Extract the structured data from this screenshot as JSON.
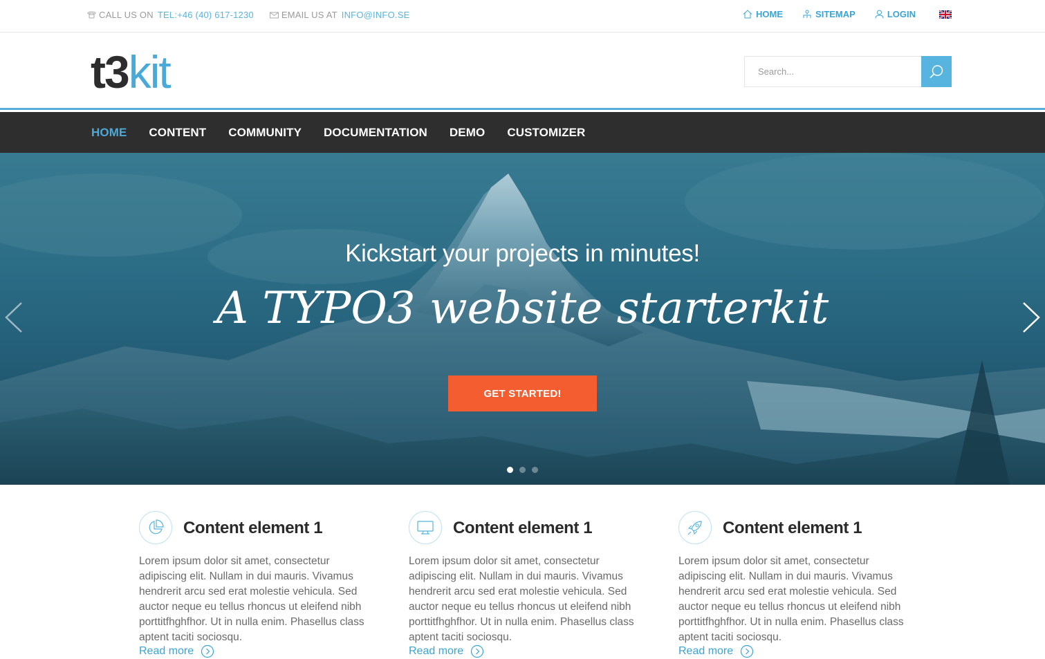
{
  "topbar": {
    "call_label": "CALL US ON",
    "call_value": "TEL:+46 (40) 617-1230",
    "email_label": "EMAIL US AT",
    "email_value": "INFO@INFO.SE",
    "links": [
      {
        "label": "HOME",
        "icon": "home-icon"
      },
      {
        "label": "SITEMAP",
        "icon": "sitemap-icon"
      },
      {
        "label": "LOGIN",
        "icon": "user-icon"
      }
    ],
    "language_flag": "uk-flag-icon"
  },
  "header": {
    "logo_dark": "t3",
    "logo_light": "kit",
    "search_placeholder": "Search..."
  },
  "nav": {
    "items": [
      "HOME",
      "CONTENT",
      "COMMUNITY",
      "DOCUMENTATION",
      "DEMO",
      "CUSTOMIZER"
    ],
    "active_index": 0
  },
  "hero": {
    "subtitle": "Kickstart your projects in minutes!",
    "title": "A TYPO3 website starterkit",
    "cta_label": "GET STARTED!",
    "slide_count": 3,
    "active_slide": 0
  },
  "features": [
    {
      "icon": "pie-chart-icon",
      "title": "Content element 1",
      "text": "Lorem ipsum dolor sit amet, consectetur adipiscing elit. Nullam in dui mauris. Vivamus hendrerit arcu sed erat molestie vehicula. Sed auctor neque eu tellus rhoncus ut eleifend nibh porttitfhghfhor. Ut in nulla enim. Phasellus class aptent taciti sociosqu.",
      "link": "Read more"
    },
    {
      "icon": "monitor-icon",
      "title": "Content element 1",
      "text": "Lorem ipsum dolor sit amet, consectetur adipiscing elit. Nullam in dui mauris. Vivamus hendrerit arcu sed erat molestie vehicula. Sed auctor neque eu tellus rhoncus ut eleifend nibh porttitfhghfhor. Ut in nulla enim. Phasellus class aptent taciti sociosqu.",
      "link": "Read more"
    },
    {
      "icon": "rocket-icon",
      "title": "Content element 1",
      "text": "Lorem ipsum dolor sit amet, consectetur adipiscing elit. Nullam in dui mauris. Vivamus hendrerit arcu sed erat molestie vehicula. Sed auctor neque eu tellus rhoncus ut eleifend nibh porttitfhghfhor. Ut in nulla enim. Phasellus class aptent taciti sociosqu.",
      "link": "Read more"
    }
  ],
  "colors": {
    "accent": "#56b4de",
    "nav_bg": "#2e2e2e",
    "cta": "#f35d2f"
  }
}
